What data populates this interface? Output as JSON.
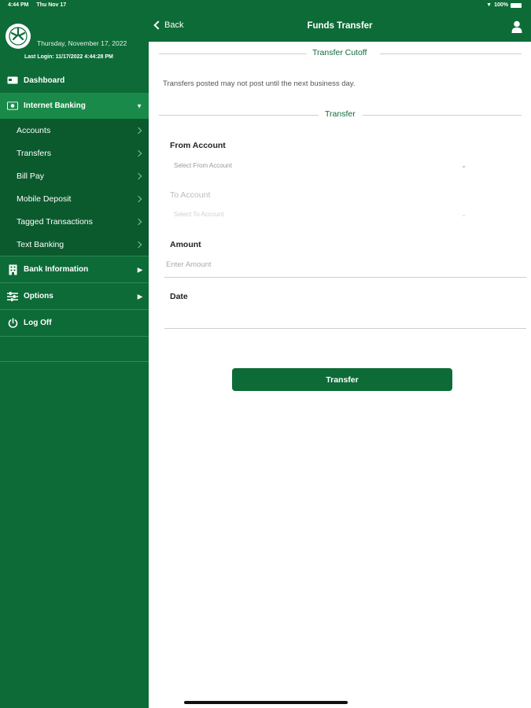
{
  "status": {
    "time": "4:44 PM",
    "day": "Thu Nov 17",
    "battery": "100%"
  },
  "profile": {
    "date": "Thursday, November 17, 2022",
    "last_login": "Last Login: 11/17/2022 4:44:28 PM"
  },
  "sidebar": {
    "dashboard": "Dashboard",
    "internet_banking": "Internet Banking",
    "sub_items": [
      {
        "label": "Accounts"
      },
      {
        "label": "Transfers"
      },
      {
        "label": "Bill Pay"
      },
      {
        "label": "Mobile Deposit"
      },
      {
        "label": "Tagged Transactions"
      },
      {
        "label": "Text Banking"
      }
    ],
    "bank_information": "Bank Information",
    "options": "Options",
    "log_off": "Log Off"
  },
  "header": {
    "back_label": "Back",
    "title": "Funds Transfer"
  },
  "sections": {
    "cutoff": "Transfer Cutoff",
    "transfer": "Transfer"
  },
  "notice": "Transfers posted may not post until the next business day.",
  "form": {
    "from_label": "From Account",
    "from_placeholder": "Select From Account",
    "to_label": "To Account",
    "to_placeholder": "Select To Account",
    "amount_label": "Amount",
    "amount_placeholder": "Enter Amount",
    "date_label": "Date",
    "submit_label": "Transfer"
  },
  "colors": {
    "brand_green": "#0d6b37",
    "active_green": "#1a8a4a",
    "sub_green": "#0a5a2d"
  }
}
